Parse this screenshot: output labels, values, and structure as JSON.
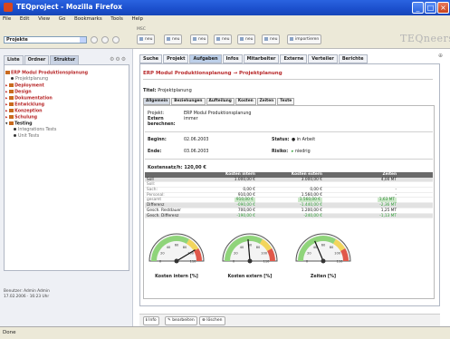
{
  "window": {
    "title": "TEQproject - Mozilla Firefox"
  },
  "menu": [
    "File",
    "Edit",
    "View",
    "Go",
    "Bookmarks",
    "Tools",
    "Help"
  ],
  "toolbar": {
    "project_select": "Projekte",
    "module_label": "MSC",
    "buttons": [
      "neu",
      "neu",
      "neu",
      "neu",
      "neu",
      "neu",
      "importieren"
    ],
    "brand": "TEQneers"
  },
  "sidebar": {
    "tabs": [
      "Liste",
      "Ordner",
      "Struktur"
    ],
    "tree": [
      {
        "label": "ERP Modul Produktionsplanung",
        "style": "red"
      },
      {
        "label": "Projektplanung",
        "style": "sub"
      },
      {
        "label": "Deployment",
        "style": "red"
      },
      {
        "label": "Design",
        "style": "red"
      },
      {
        "label": "Dokumentation",
        "style": "red"
      },
      {
        "label": "Entwicklung",
        "style": "red"
      },
      {
        "label": "Konzeption",
        "style": "red"
      },
      {
        "label": "Schulung",
        "style": "red"
      },
      {
        "label": "Testing",
        "style": "bold"
      },
      {
        "label": "Integrations Tests",
        "style": "sub"
      },
      {
        "label": "Unit Tests",
        "style": "sub"
      }
    ],
    "footer": [
      "Benutzer: Admin Admin",
      "17.02.2006 · 16:23 Uhr"
    ]
  },
  "content": {
    "tabs": [
      "Suche",
      "Projekt",
      "Aufgaben",
      "Infos",
      "Mitarbeiter",
      "Externe",
      "Verteiler",
      "Berichte"
    ],
    "breadcrumb": "ERP Modul Produktionsplanung → Projektplanung",
    "title_label": "Titel:",
    "title_value": "Projektplanung",
    "inner_tabs": [
      "Allgemein",
      "Beziehungen",
      "Aufteilung",
      "Kosten",
      "Zeiten",
      "Texte"
    ],
    "fields": {
      "projekt_label": "Projekt:",
      "projekt_value": "ERP Modul Produktionsplanung",
      "extern_label": "Extern berechnen:",
      "extern_value": "immer",
      "beginn_label": "Beginn:",
      "beginn_value": "02.06.2003",
      "ende_label": "Ende:",
      "ende_value": "03.06.2003",
      "status_label": "Status:",
      "status_value": "in Arbeit",
      "risiko_label": "Risiko:",
      "risiko_value": "niedrig"
    },
    "kosten_header": "Kostensatz/h: 120,00 €",
    "table": {
      "columns": [
        "",
        "Kosten intern",
        "Kosten extern",
        "Zeiten"
      ],
      "rows": [
        [
          "Soll",
          "1.000,00 €",
          "3.000,00 €",
          "4,00 MT"
        ],
        [
          "Soll:",
          "",
          "",
          ""
        ],
        [
          "Sach:",
          "0,00 €",
          "0,00 €",
          "-"
        ],
        [
          "Personal:",
          "910,00 €",
          "1.560,00 €",
          "-"
        ],
        [
          "gesamt",
          "910,00 €",
          "1.560,00 €",
          "1,63 MT"
        ],
        [
          "Differenz",
          "-090,00 €",
          "-1.440,00 €",
          "-2,36 MT"
        ],
        [
          "Gesch. Restdauer",
          "700,00 €",
          "1.200,00 €",
          "1,25 MT"
        ],
        [
          "Gesch. Differenz",
          "-190,00 €",
          "-240,00 €",
          "-1,13 MT"
        ]
      ]
    },
    "gauges": [
      {
        "label": "Kosten intern [%]",
        "value": 91
      },
      {
        "label": "Kosten extern [%]",
        "value": 52
      },
      {
        "label": "Zeiten [%]",
        "value": 41
      }
    ],
    "gauge_ticks": [
      "0",
      "20",
      "40",
      "60",
      "80",
      "100",
      "110"
    ],
    "bottom_buttons": [
      "Info",
      "bearbeiten",
      "löschen"
    ]
  },
  "status": "Done",
  "colors": {
    "accent_red": "#b8292a",
    "titlebar": "#2a63e0",
    "ok_green": "#34a13b"
  }
}
